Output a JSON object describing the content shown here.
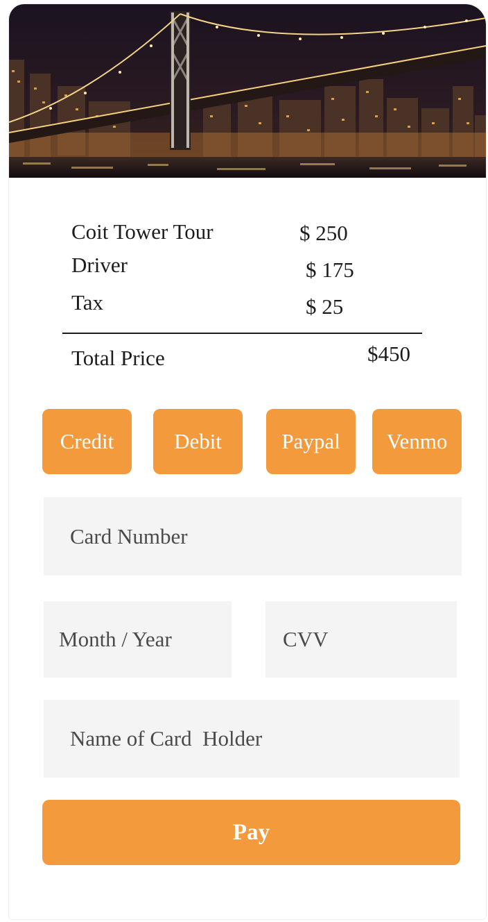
{
  "summary": {
    "items": [
      {
        "label": "Coit Tower Tour",
        "price": "$ 250"
      },
      {
        "label": "Driver",
        "price": "$ 175"
      },
      {
        "label": "Tax",
        "price": "$ 25"
      }
    ],
    "total_label": "Total Price",
    "total_value": "$450"
  },
  "payment_methods": [
    "Credit",
    "Debit",
    "Paypal",
    "Venmo"
  ],
  "form": {
    "card_number_placeholder": "Card Number",
    "expiry_placeholder": "Month / Year",
    "cvv_placeholder": "CVV",
    "holder_placeholder": "Name of Card  Holder"
  },
  "pay_label": "Pay",
  "colors": {
    "accent": "#f39a3d",
    "field_bg": "#f4f4f4",
    "text": "#1c1c1c"
  },
  "hero": {
    "icon": "bay-bridge-night-photo"
  }
}
